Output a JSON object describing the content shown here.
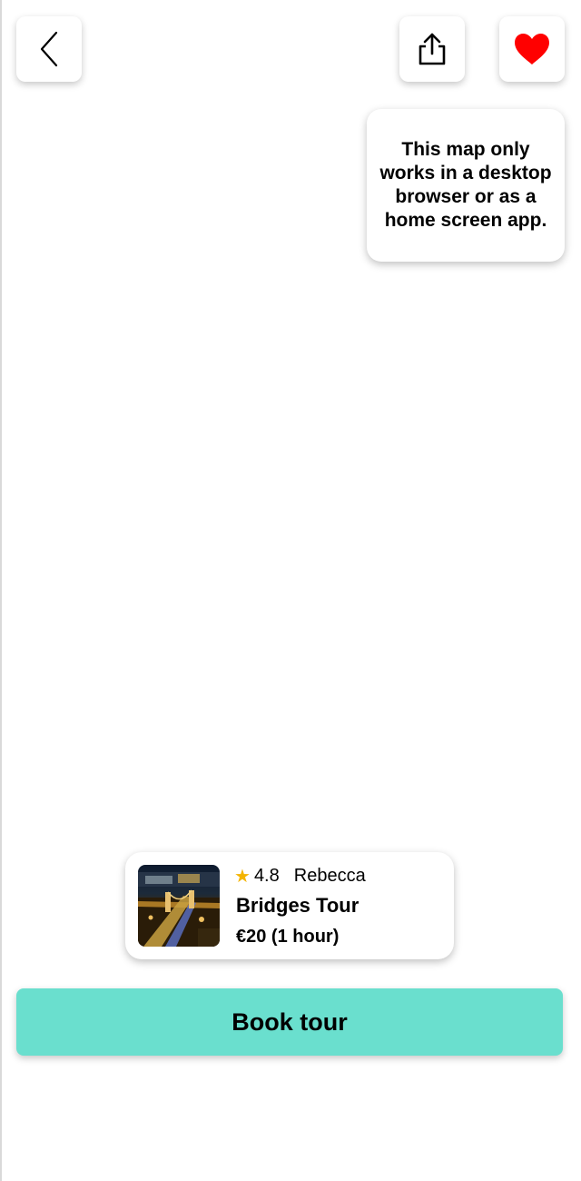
{
  "header": {
    "back_icon": "chevron-left-icon",
    "share_icon": "share-icon",
    "favorite_icon": "heart-icon",
    "favorite_color": "#ff0000"
  },
  "map": {
    "notice": "This map only works in a desktop browser or as a home screen app."
  },
  "tour": {
    "rating": "4.8",
    "rating_icon": "star-icon",
    "star_color": "#f4b400",
    "guide": "Rebecca",
    "title": "Bridges Tour",
    "price": "€20 (1 hour)"
  },
  "actions": {
    "book_label": "Book tour",
    "book_color": "#6adfce"
  }
}
